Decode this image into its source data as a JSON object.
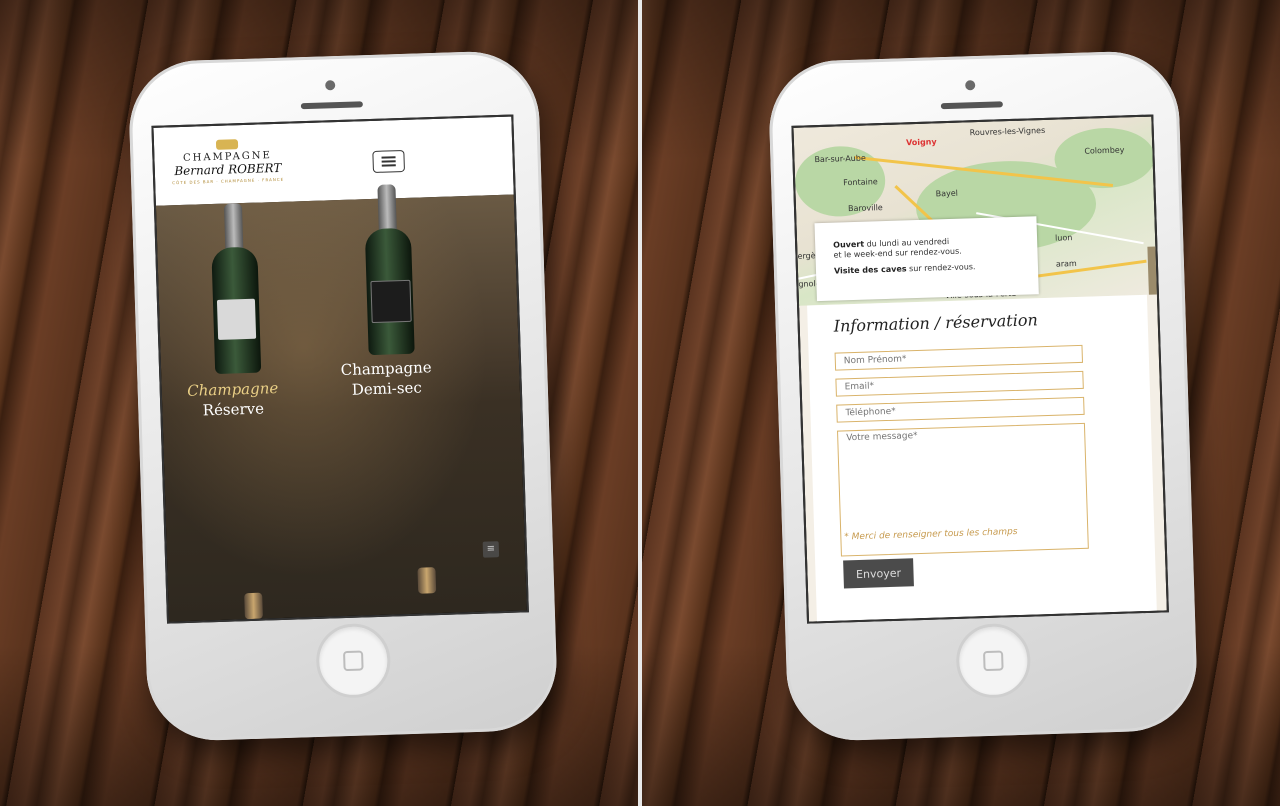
{
  "site": {
    "logo": {
      "top": "CHAMPAGNE",
      "name": "Bernard ROBERT",
      "sub": "CÔTE DES BAR · CHAMPAGNE · FRANCE"
    },
    "products": [
      {
        "line1": "Champagne",
        "line2": "Réserve"
      },
      {
        "line1": "Champagne",
        "line2": "Demi-sec"
      }
    ]
  },
  "map": {
    "towns": [
      "Voigny",
      "Rouvres-les-Vignes",
      "Bar-sur-Aube",
      "Colombey",
      "Fontaine",
      "Bayel",
      "Baroville",
      "Ville-sous-la-Ferté",
      "ergères",
      "gnol-",
      "luon",
      "aram"
    ],
    "card": {
      "open_bold": "Ouvert",
      "open_text": "du lundi au vendredi",
      "open_text2": "et le week-end sur rendez-vous.",
      "visit_bold": "Visite des caves",
      "visit_text": "sur rendez-vous."
    }
  },
  "form": {
    "title": "Information / réservation",
    "name_placeholder": "Nom Prénom*",
    "email_placeholder": "Email*",
    "phone_placeholder": "Téléphone*",
    "message_placeholder": "Votre message*",
    "note": "* Merci de renseigner tous les champs",
    "submit": "Envoyer"
  },
  "colors": {
    "gold": "#c79b4f",
    "button": "#4b4b4b"
  }
}
